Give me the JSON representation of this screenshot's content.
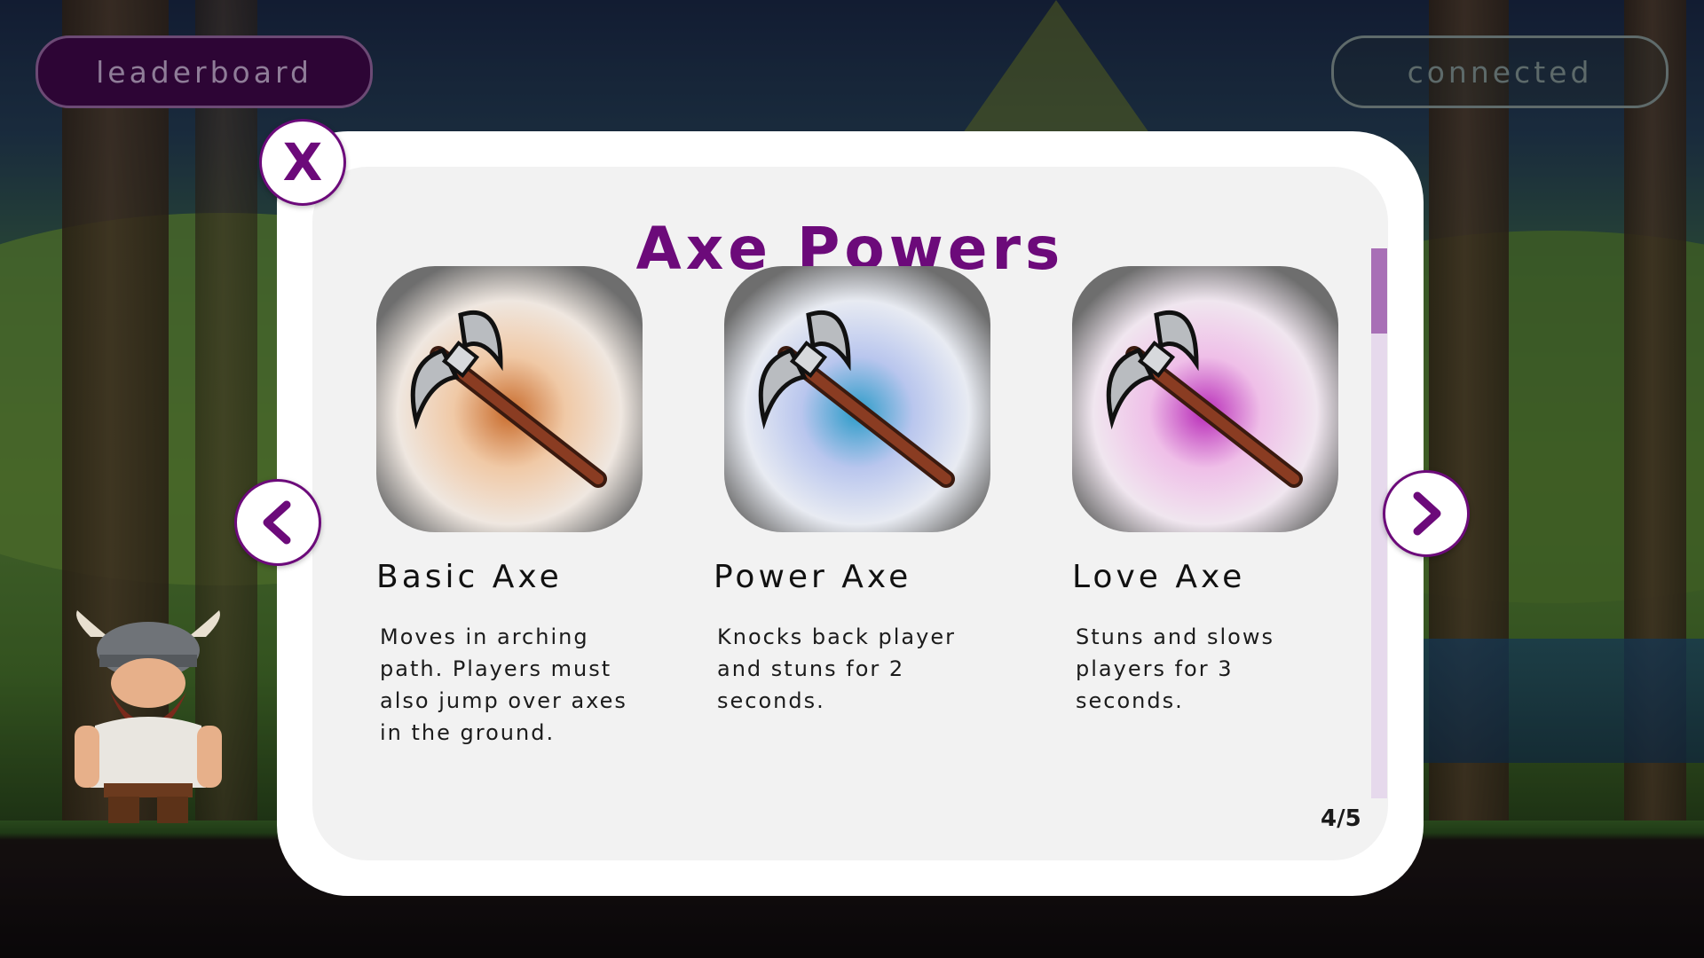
{
  "top_bar": {
    "leaderboard_label": "leaderboard",
    "connection_status": "connected"
  },
  "modal": {
    "close_label": "X",
    "title": "Axe Powers",
    "page_counter": "4/5",
    "cards": [
      {
        "name": "Basic Axe",
        "description": "Moves in arching path. Players must also jump over axes in the ground.",
        "icon": "axe-icon",
        "glow_color": "#c86a2a"
      },
      {
        "name": "Power Axe",
        "description": "Knocks back player and stuns for 2 seconds.",
        "icon": "axe-icon",
        "glow_color": "#2a9bc8"
      },
      {
        "name": "Love Axe",
        "description": "Stuns and slows players for 3 seconds.",
        "icon": "axe-icon",
        "glow_color": "#b82ab8"
      }
    ]
  },
  "colors": {
    "accent": "#6c0a7a",
    "scroll_track": "#e6d9ec",
    "scroll_thumb": "#a86fb6"
  }
}
